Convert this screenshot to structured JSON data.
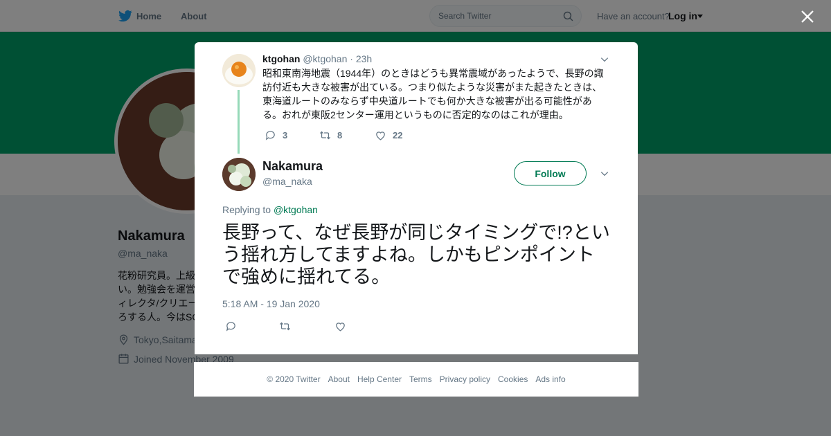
{
  "nav": {
    "home": "Home",
    "about": "About",
    "search_placeholder": "Search Twitter",
    "have_account": "Have an account?",
    "login": "Log in"
  },
  "profile": {
    "name": "Nakamura",
    "handle": "@ma_naka",
    "bio": "花粉研究員。上級\nい。勉強会を運営\nィレクタ/クリエー\nろする人。今はSC",
    "location": "Tokyo,Saitama",
    "joined": "Joined November 2009"
  },
  "parent_tweet": {
    "name": "ktgohan",
    "handle": "@ktgohan",
    "separator": "·",
    "time": "23h",
    "text": "昭和東南海地震（1944年）のときはどうも異常震域があったようで、長野の諏訪付近も大きな被害が出ている。つまり似たような災害がまた起きたときは、東海道ルートのみならず中央道ルートでも何か大きな被害が出る可能性がある。おれが東阪2センター運用というものに否定的なのはこれが理由。",
    "replies": "3",
    "retweets": "8",
    "likes": "22"
  },
  "main_tweet": {
    "name": "Nakamura",
    "handle": "@ma_naka",
    "follow_label": "Follow",
    "replying_prefix": "Replying to",
    "replying_to": "@ktgohan",
    "text": "長野って、なぜ長野が同じタイミングで!?という揺れ方してますよね。しかもピンポイントで強めに揺れてる。",
    "timestamp": "5:18 AM - 19 Jan 2020"
  },
  "footer": {
    "copyright": "© 2020 Twitter",
    "about": "About",
    "help": "Help Center",
    "terms": "Terms",
    "privacy": "Privacy policy",
    "cookies": "Cookies",
    "ads": "Ads info"
  },
  "colors": {
    "brand_green": "#007a53",
    "banner_green": "#00a069",
    "twitter_blue": "#1da1f2",
    "secondary_text": "#657786"
  },
  "icons": {
    "logo": "twitter-bird-icon",
    "search": "search-icon",
    "close": "close-icon",
    "reply": "reply-icon",
    "retweet": "retweet-icon",
    "like": "heart-icon",
    "caret": "chevron-down-icon",
    "location": "location-pin-icon",
    "calendar": "calendar-icon"
  }
}
